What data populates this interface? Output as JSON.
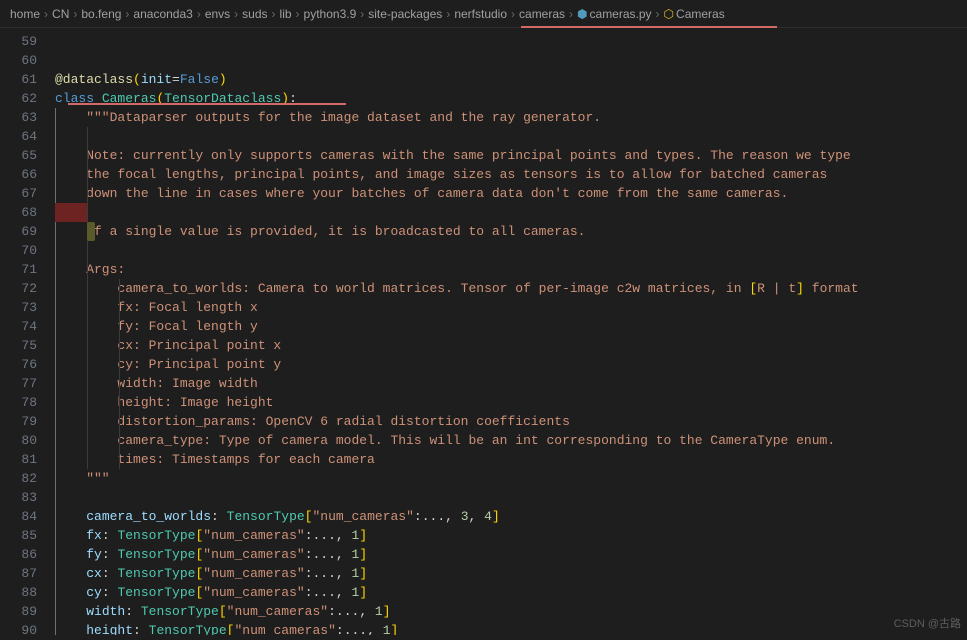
{
  "breadcrumbs": {
    "items": [
      {
        "label": "home"
      },
      {
        "label": "CN"
      },
      {
        "label": "bo.feng"
      },
      {
        "label": "anaconda3"
      },
      {
        "label": "envs"
      },
      {
        "label": "suds"
      },
      {
        "label": "lib"
      },
      {
        "label": "python3.9"
      },
      {
        "label": "site-packages"
      },
      {
        "label": "nerfstudio"
      },
      {
        "label": "cameras"
      },
      {
        "label": "cameras.py",
        "icon": "python-file-icon"
      },
      {
        "label": "Cameras",
        "icon": "class-symbol-icon"
      }
    ]
  },
  "gutter": {
    "start": 59,
    "end": 90
  },
  "code": {
    "decorator": "@dataclass",
    "decorator_arg": "init",
    "decorator_val": "False",
    "class_kw": "class",
    "class_name": "Cameras",
    "class_base": "TensorDataclass",
    "doc_open": "\"\"\"",
    "doc_l1": "Dataparser outputs for the image dataset and the ray generator.",
    "doc_note1": "Note: currently only supports cameras with the same principal points and types. The reason we type",
    "doc_note2": "the focal lengths, principal points, and image sizes as tensors is to allow for batched cameras",
    "doc_note3": "down the line in cases where your batches of camera data don't come from the same cameras.",
    "doc_single": "If a single value is provided, it is broadcasted to all cameras.",
    "doc_args": "Args:",
    "doc_arg_c2w": "camera_to_worlds: Camera to world matrices. Tensor of per-image c2w matrices, in ",
    "doc_arg_c2w_rt1": "[",
    "doc_arg_c2w_rt2": "R | t",
    "doc_arg_c2w_rt3": "]",
    "doc_arg_c2w_tail": " format",
    "doc_arg_fx": "fx: Focal length x",
    "doc_arg_fy": "fy: Focal length y",
    "doc_arg_cx": "cx: Principal point x",
    "doc_arg_cy": "cy: Principal point y",
    "doc_arg_w": "width: Image width",
    "doc_arg_h": "height: Image height",
    "doc_arg_dist": "distortion_params: OpenCV 6 radial distortion coefficients",
    "doc_arg_ctype": "camera_type: Type of camera model. This will be an int corresponding to the CameraType enum.",
    "doc_arg_times": "times: Timestamps for each camera",
    "doc_close": "\"\"\"",
    "ellipsis": "...",
    "annot": {
      "ctw": {
        "name": "camera_to_worlds",
        "type": "TensorType",
        "key": "\"num_cameras\"",
        "dims": ", 3, 4"
      },
      "fx": {
        "name": "fx",
        "type": "TensorType",
        "key": "\"num_cameras\"",
        "dims": ", 1"
      },
      "fy": {
        "name": "fy",
        "type": "TensorType",
        "key": "\"num_cameras\"",
        "dims": ", 1"
      },
      "cx": {
        "name": "cx",
        "type": "TensorType",
        "key": "\"num_cameras\"",
        "dims": ", 1"
      },
      "cy": {
        "name": "cy",
        "type": "TensorType",
        "key": "\"num_cameras\"",
        "dims": ", 1"
      },
      "width": {
        "name": "width",
        "type": "TensorType",
        "key": "\"num_cameras\"",
        "dims": ", 1"
      },
      "height": {
        "name": "height",
        "type": "TensorType",
        "key": "\"num_cameras\"",
        "dims": ", 1"
      }
    }
  },
  "watermark": "CSDN @古路"
}
